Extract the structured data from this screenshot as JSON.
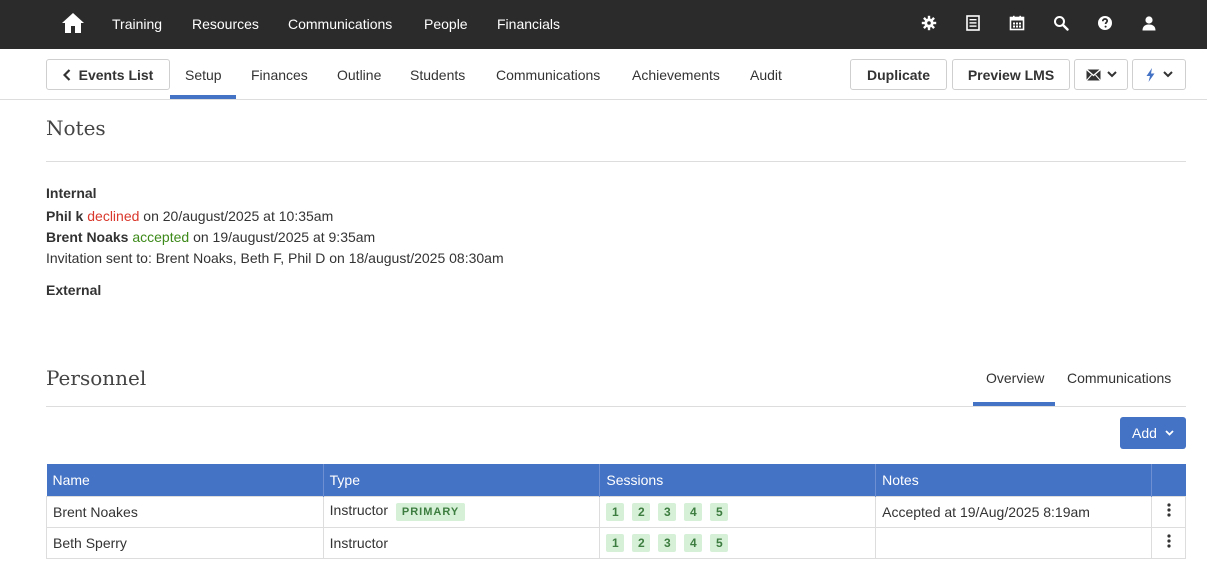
{
  "topnav": {
    "items": [
      "Training",
      "Resources",
      "Communications",
      "People",
      "Financials"
    ],
    "icons": [
      "gear-icon",
      "list-icon",
      "calendar-icon",
      "search-icon",
      "help-icon",
      "user-icon"
    ]
  },
  "subnav": {
    "back_label": "Events List",
    "tabs": [
      "Setup",
      "Finances",
      "Outline",
      "Students",
      "Communications",
      "Achievements",
      "Audit"
    ],
    "active_tab": "Setup",
    "duplicate_label": "Duplicate",
    "preview_label": "Preview LMS"
  },
  "notes": {
    "title": "Notes",
    "internal_label": "Internal",
    "lines": [
      {
        "name": "Phil k",
        "status": "declined",
        "rest": " on 20/august/2025 at 10:35am"
      },
      {
        "name": "Brent Noaks",
        "status": "accepted",
        "rest": " on 19/august/2025 at 9:35am"
      }
    ],
    "invitation": "Invitation sent to: Brent Noaks, Beth F, Phil D on 18/august/2025 08:30am",
    "external_label": "External"
  },
  "personnel": {
    "title": "Personnel",
    "tabs": [
      "Overview",
      "Communications"
    ],
    "active_tab": "Overview",
    "add_label": "Add",
    "columns": [
      "Name",
      "Type",
      "Sessions",
      "Notes"
    ],
    "rows": [
      {
        "name": "Brent Noakes",
        "type": "Instructor",
        "badge": "PRIMARY",
        "sessions": [
          "1",
          "2",
          "3",
          "4",
          "5"
        ],
        "notes": "Accepted at 19/Aug/2025 8:19am"
      },
      {
        "name": "Beth Sperry",
        "type": "Instructor",
        "badge": "",
        "sessions": [
          "1",
          "2",
          "3",
          "4",
          "5"
        ],
        "notes": ""
      }
    ]
  },
  "colors": {
    "navbar": "#2b2b2b",
    "accent": "#4472c4",
    "declined": "#d9372b",
    "accepted": "#3d8a1a",
    "badge_bg": "#d6f0d8"
  }
}
